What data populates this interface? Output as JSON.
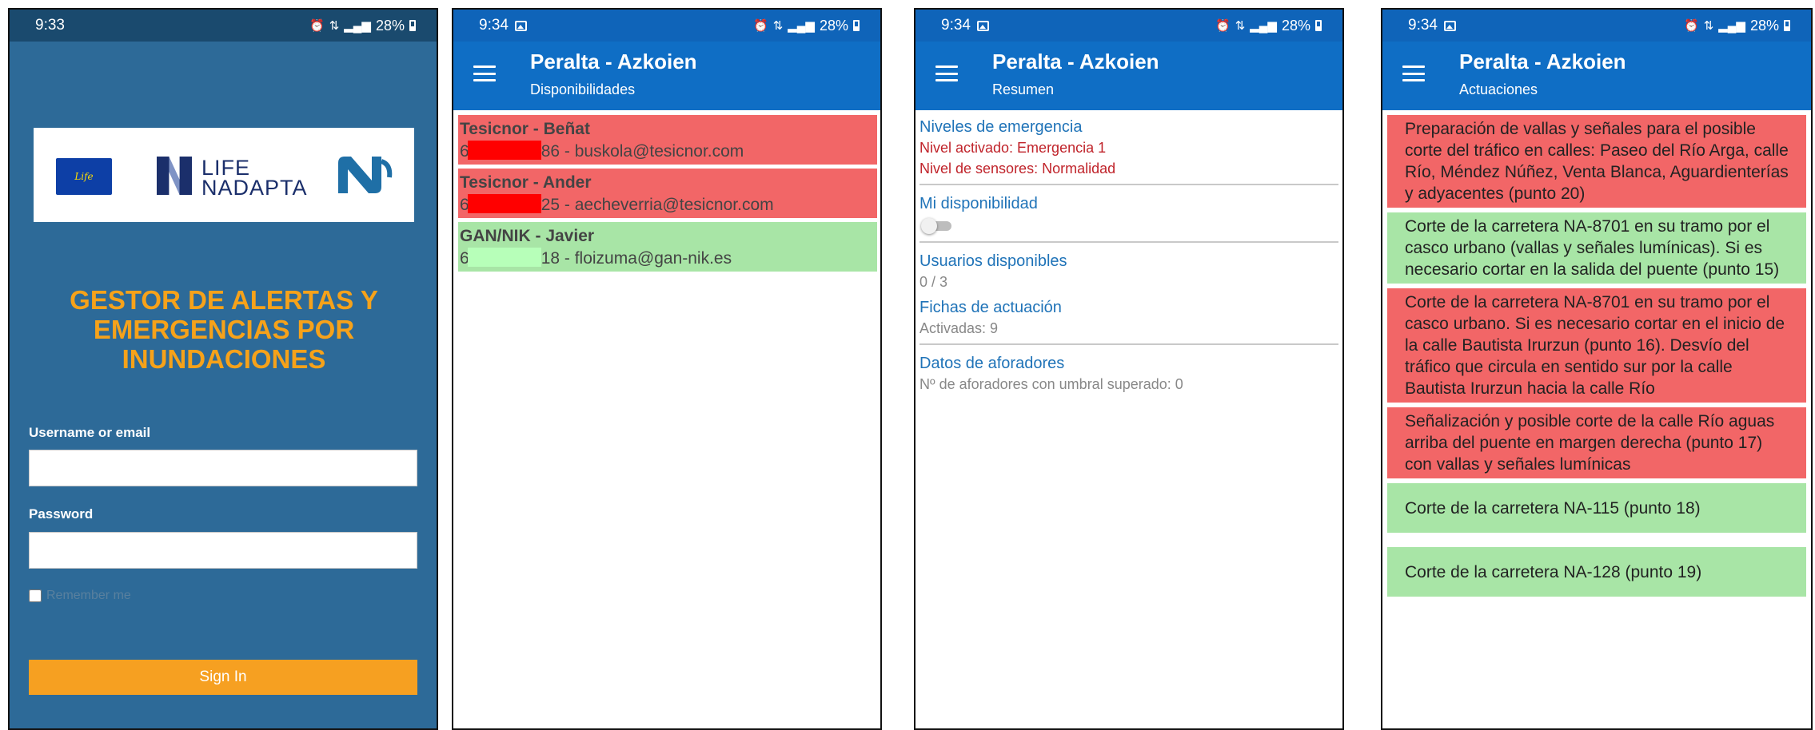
{
  "login": {
    "status_time": "9:33",
    "status_battery": "28%",
    "logo_text_line1": "LIFE",
    "logo_text_line2": "NADAPTA",
    "eu_label": "Life",
    "title_line1": "GESTOR DE ALERTAS Y",
    "title_line2": "EMERGENCIAS POR",
    "title_line3": "INUNDACIONES",
    "username_label": "Username or email",
    "username_value": "",
    "password_label": "Password",
    "password_value": "",
    "remember_label": "Remember me",
    "signin_label": "Sign In"
  },
  "disponibilidades": {
    "status_time": "9:34",
    "status_battery": "28%",
    "app_title": "Peralta - Azkoien",
    "subtitle": "Disponibilidades",
    "items": [
      {
        "name": "Tesicnor - Beñat",
        "phone_prefix": "6",
        "phone_suffix": "86",
        "email": " - buskola@tesicnor.com",
        "status": "red"
      },
      {
        "name": "Tesicnor - Ander",
        "phone_prefix": "6",
        "phone_suffix": "25",
        "email": " - aecheverria@tesicnor.com",
        "status": "red"
      },
      {
        "name": "GAN/NIK - Javier",
        "phone_prefix": "6",
        "phone_suffix": "18",
        "email": " - floizuma@gan-nik.es",
        "status": "green"
      }
    ]
  },
  "resumen": {
    "status_time": "9:34",
    "status_battery": "28%",
    "app_title": "Peralta - Azkoien",
    "subtitle": "Resumen",
    "niveles_title": "Niveles de emergencia",
    "nivel_activado": "Nivel activado: Emergencia 1",
    "nivel_sensores": "Nivel de sensores: Normalidad",
    "disponibilidad_title": "Mi disponibilidad",
    "disponibilidad_on": false,
    "usuarios_title": "Usuarios disponibles",
    "usuarios_value": "0 / 3",
    "fichas_title": "Fichas de actuación",
    "fichas_value": "Activadas: 9",
    "aforadores_title": "Datos de aforadores",
    "aforadores_value": "Nº de aforadores con umbral superado: 0"
  },
  "actuaciones": {
    "status_time": "9:34",
    "status_battery": "28%",
    "app_title": "Peralta - Azkoien",
    "subtitle": "Actuaciones",
    "items": [
      {
        "text": "Preparación de vallas y señales para el posible corte del tráfico en calles: Paseo del Río Arga, calle Río, Méndez Núñez, Venta Blanca, Aguardienterías y adyacentes (punto 20)",
        "status": "red"
      },
      {
        "text": "Corte de la carretera NA-8701 en su tramo por el casco urbano (vallas y señales lumínicas). Si es necesario cortar en la salida del puente (punto 15)",
        "status": "green"
      },
      {
        "text": "Corte de la carretera NA-8701 en su tramo por el casco urbano. Si es necesario cortar en el inicio de la calle Bautista Irurzun (punto 16). Desvío del tráfico que circula en sentido sur por la calle Bautista Irurzun hacia la calle Río",
        "status": "red"
      },
      {
        "text": "Señalización y posible corte de la calle Río aguas arriba del puente en margen derecha (punto 17) con vallas y señales lumínicas",
        "status": "red"
      },
      {
        "text": "Corte de la carretera NA-115 (punto 18)",
        "status": "green"
      },
      {
        "text": "Corte de la carretera NA-128 (punto 19)",
        "status": "green"
      }
    ]
  },
  "colors": {
    "login_bg": "#2d6a98",
    "title_orange": "#f6a21a",
    "appbar_blue": "#0f6ec5",
    "row_red": "#f26667",
    "row_green": "#a8e5a6",
    "link_blue": "#1f73b8",
    "alert_red": "#c0232a"
  }
}
